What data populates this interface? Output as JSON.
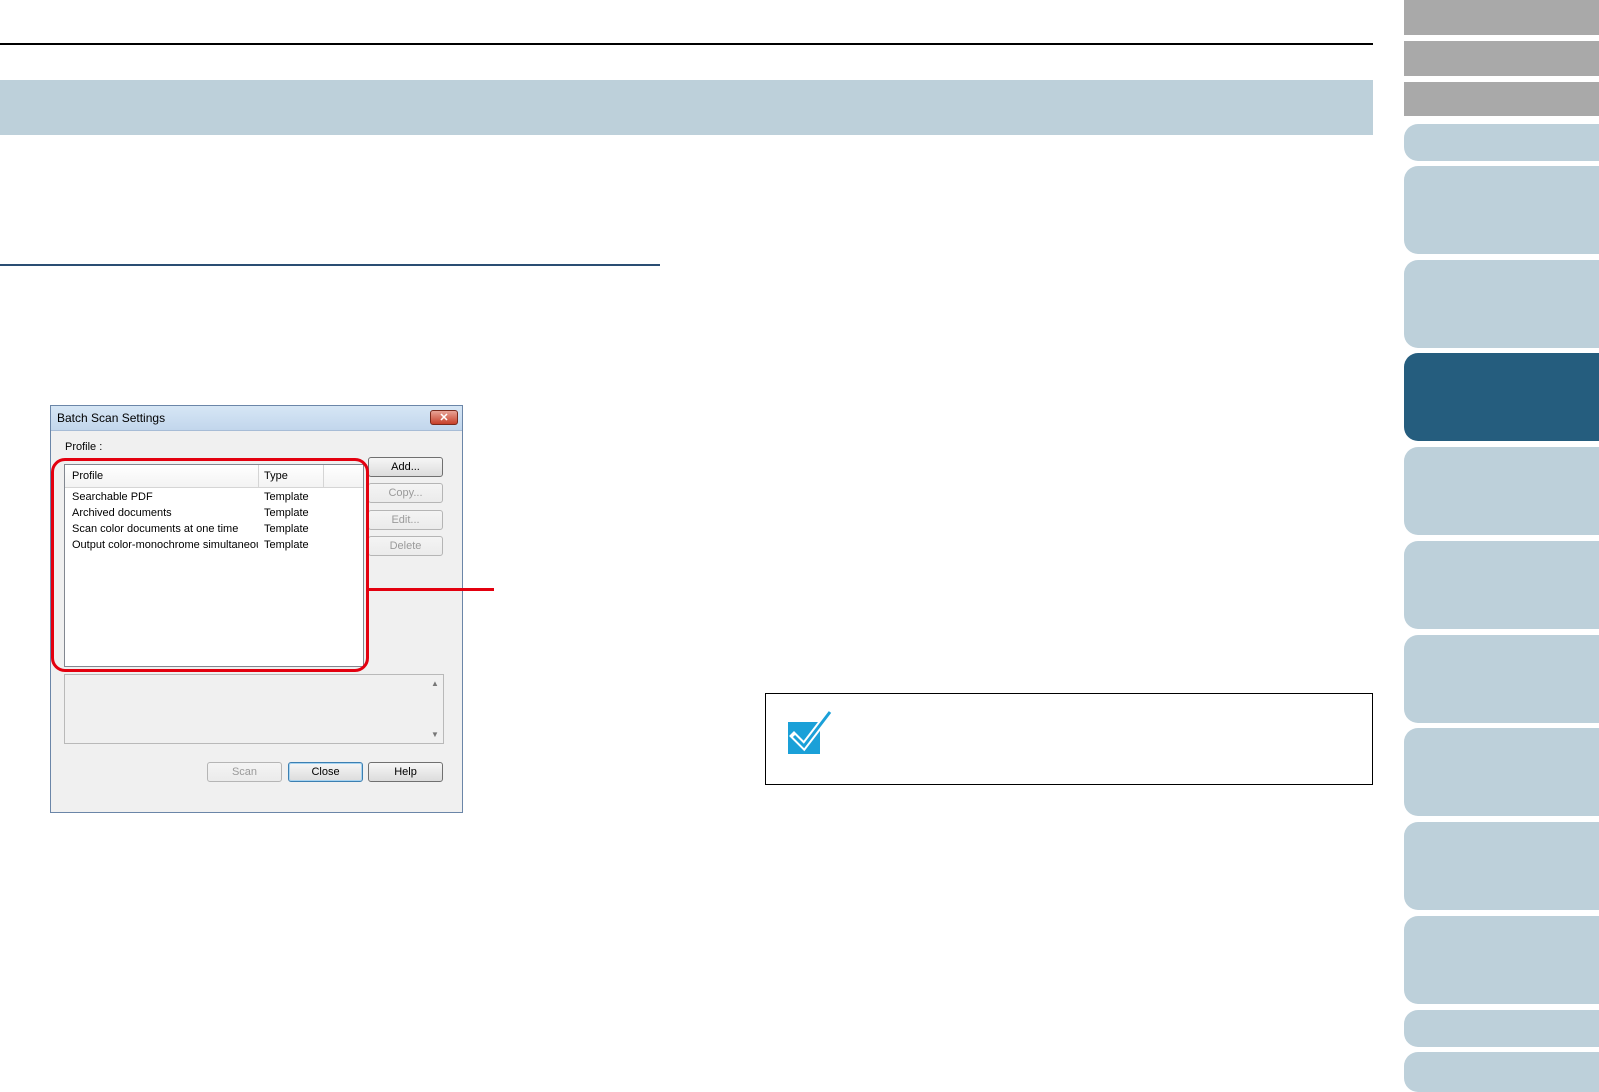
{
  "dialog": {
    "title": "Batch Scan Settings",
    "close_glyph": "✕",
    "profile_label": "Profile :",
    "columns": [
      "Profile",
      "Type"
    ],
    "rows": [
      {
        "profile": "Searchable PDF",
        "type": "Template"
      },
      {
        "profile": "Archived documents",
        "type": "Template"
      },
      {
        "profile": "Scan color documents at one time",
        "type": "Template"
      },
      {
        "profile": "Output color-monochrome simultaneously",
        "type": "Template"
      }
    ],
    "buttons": {
      "add": "Add...",
      "copy": "Copy...",
      "edit": "Edit...",
      "delete": "Delete",
      "scan": "Scan",
      "close": "Close",
      "help": "Help"
    }
  },
  "colors": {
    "highlight": "#e3000f",
    "title_band": "#bdd0da",
    "active_tab": "#255d7e",
    "note_icon": "#1aa0d8"
  },
  "icons": [
    "check-icon",
    "close-icon",
    "scroll-up-icon",
    "scroll-down-icon"
  ]
}
